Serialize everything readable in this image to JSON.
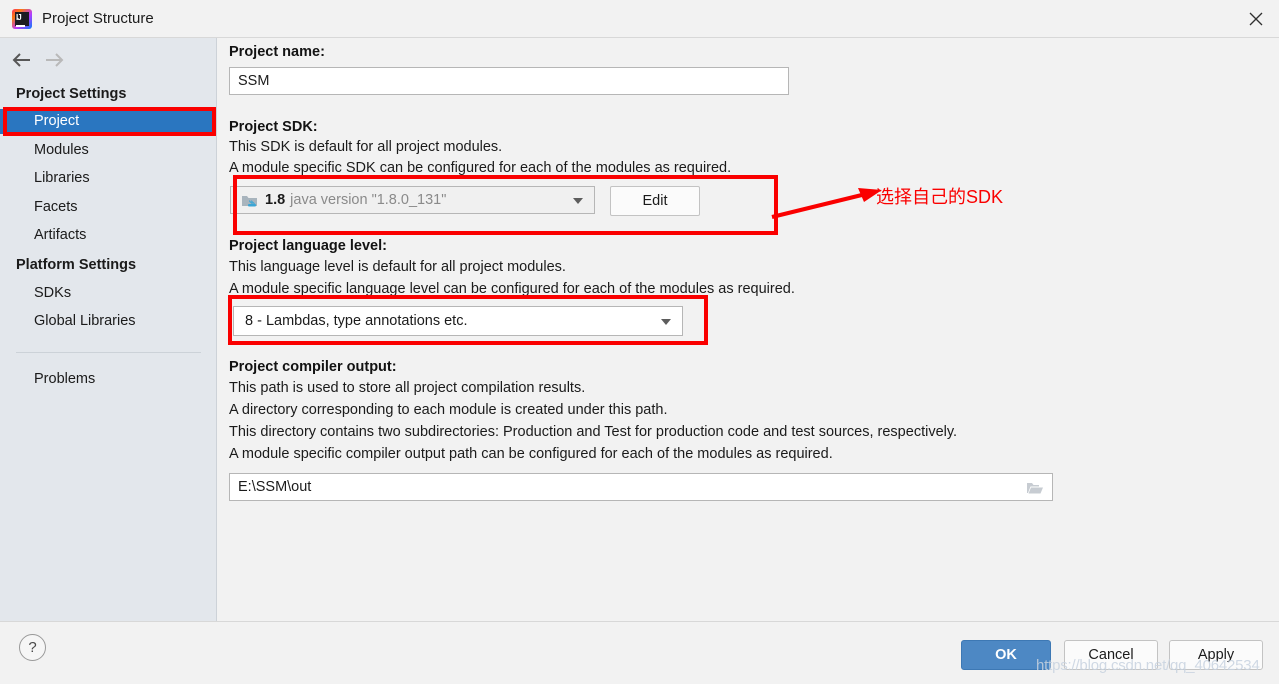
{
  "window": {
    "title": "Project Structure",
    "app_icon": "intellij-idea-icon",
    "close_icon": "close-icon"
  },
  "sidebar": {
    "nav": {
      "back_icon": "arrow-left-icon",
      "forward_icon": "arrow-right-icon"
    },
    "sections": [
      {
        "title": "Project Settings",
        "items": [
          {
            "label": "Project",
            "selected": true
          },
          {
            "label": "Modules",
            "selected": false
          },
          {
            "label": "Libraries",
            "selected": false
          },
          {
            "label": "Facets",
            "selected": false
          },
          {
            "label": "Artifacts",
            "selected": false
          }
        ]
      },
      {
        "title": "Platform Settings",
        "items": [
          {
            "label": "SDKs",
            "selected": false
          },
          {
            "label": "Global Libraries",
            "selected": false
          }
        ]
      }
    ],
    "problems": {
      "label": "Problems"
    }
  },
  "main": {
    "project_name": {
      "label": "Project name:",
      "value": "SSM"
    },
    "project_sdk": {
      "label": "Project SDK:",
      "desc_line1": "This SDK is default for all project modules.",
      "desc_line2": "A module specific SDK can be configured for each of the modules as required.",
      "sdk_icon": "java-sdk-icon",
      "sdk_version": "1.8",
      "sdk_description": "java version \"1.8.0_131\"",
      "dropdown_icon": "chevron-down-icon",
      "edit_label": "Edit"
    },
    "language_level": {
      "label": "Project language level:",
      "desc_line1": "This language level is default for all project modules.",
      "desc_line2": "A module specific language level can be configured for each of the modules as required.",
      "value": "8 - Lambdas, type annotations etc.",
      "dropdown_icon": "chevron-down-icon"
    },
    "compiler_output": {
      "label": "Project compiler output:",
      "desc_line1": "This path is used to store all project compilation results.",
      "desc_line2": "A directory corresponding to each module is created under this path.",
      "desc_line3": "This directory contains two subdirectories: Production and Test for production code and test sources, respectively.",
      "desc_line4": "A module specific compiler output path can be configured for each of the modules as required.",
      "value": "E:\\SSM\\out",
      "browse_icon": "folder-icon"
    }
  },
  "annotations": {
    "note_text": "选择自己的SDK",
    "arrow_icon": "red-arrow-icon",
    "color": "#fa0000"
  },
  "footer": {
    "help_label": "?",
    "ok_label": "OK",
    "cancel_label": "Cancel",
    "apply_label": "Apply"
  },
  "watermark": {
    "text": "https://blog.csdn.net/qq_40642534"
  },
  "colors": {
    "selection_blue": "#2a76c0",
    "ok_blue": "#4d88c4",
    "annotation_red": "#fa0000",
    "sidebar_bg": "#e3e7ec",
    "panel_bg": "#f2f2f2"
  }
}
